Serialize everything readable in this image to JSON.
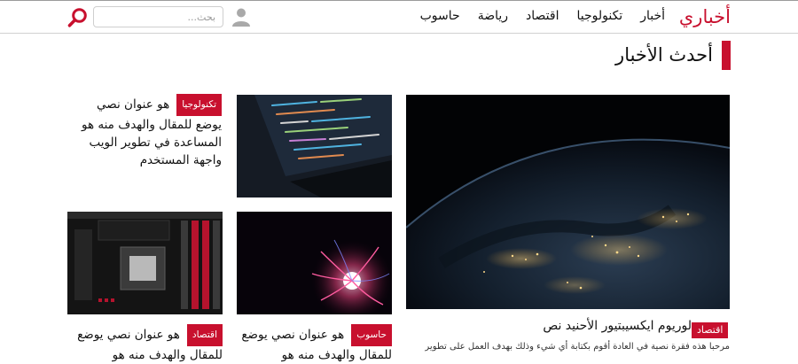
{
  "header": {
    "logo": "أخباري",
    "nav": [
      "أخبار",
      "تكنولوجيا",
      "اقتصاد",
      "رياضة",
      "حاسوب"
    ],
    "search_placeholder": "بحث...",
    "icons": {
      "search": "search-icon",
      "user": "user-icon"
    }
  },
  "section": {
    "title": "أحدث الأخبار"
  },
  "featured": {
    "category": "اقتصاد",
    "title": "لوريوم ايكسيبتيور الأحنيد نص",
    "excerpt": "مرحبا هذه فقرة نصية في العادة أقوم بكتابة أي شيء وذلك بهدف العمل على تطوير"
  },
  "cards": [
    {
      "category": "تكنولوجيا",
      "title": "هو عنوان نصي",
      "body": "يوضع للمقال والهدف منه هو المساعدة في تطوير الويب واجهة المستخدم"
    },
    {
      "category": "حاسوب",
      "title": "هو عنوان نصي يوضع للمقال والهدف منه هو"
    },
    {
      "category": "اقتصاد",
      "title": "هو عنوان نصي يوضع للمقال والهدف منه هو"
    }
  ],
  "colors": {
    "accent": "#c8102e"
  }
}
